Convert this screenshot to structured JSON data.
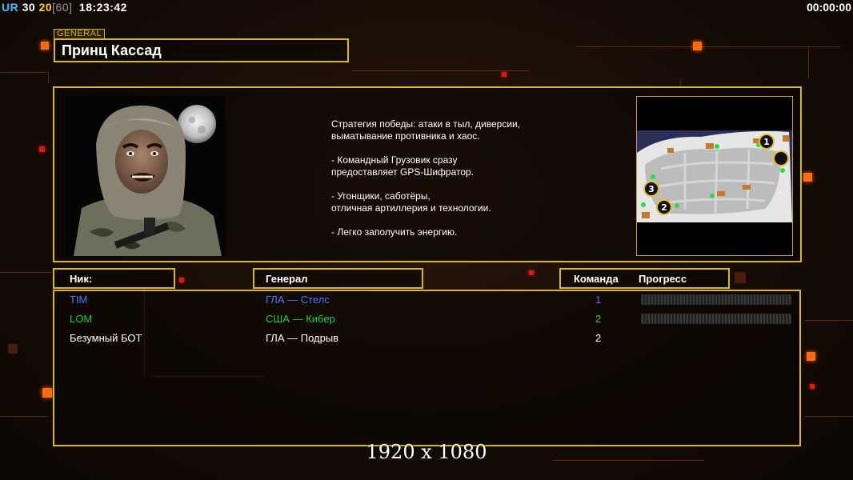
{
  "hud": {
    "ur": "UR",
    "val_a": "30",
    "val_b": "20",
    "val_c": "[60]",
    "clock": "18:23:42",
    "timer": "00:00:00"
  },
  "general": {
    "tag": "GENERAL",
    "name": "Принц Кассад",
    "strategy": "Стратегия победы: атаки в тыл, диверсии,\n выматывание противника и хаос.\n\n- Командный Грузовик сразу\nпредоставляет GPS-Шифратор.\n\n- Угонщики, саботёры,\nотличная артиллерия и технологии.\n\n- Легко заполучить энергию.",
    "map_markers": [
      "1",
      "2",
      "3"
    ]
  },
  "table": {
    "headers": {
      "nick": "Ник:",
      "general": "Генерал",
      "team": "Команда",
      "progress": "Прогресс"
    },
    "rows": [
      {
        "nick": "TIM",
        "general": "ГЛА — Стелс",
        "team": "1",
        "color": "#4a78ff",
        "progress_bar": true
      },
      {
        "nick": "LOM",
        "general": "США — Кибер",
        "team": "2",
        "color": "#20d040",
        "progress_bar": true
      },
      {
        "nick": "Безумный БОТ",
        "general": "ГЛА — Подрыв",
        "team": "2",
        "color": "#ffffff",
        "progress_bar": false
      }
    ]
  },
  "watermark": "1920 x 1080",
  "colors": {
    "accent_gold": "#d8b820",
    "player_blue": "#4a78ff",
    "player_green": "#20d040",
    "highlight_orange": "#ff6a10"
  }
}
